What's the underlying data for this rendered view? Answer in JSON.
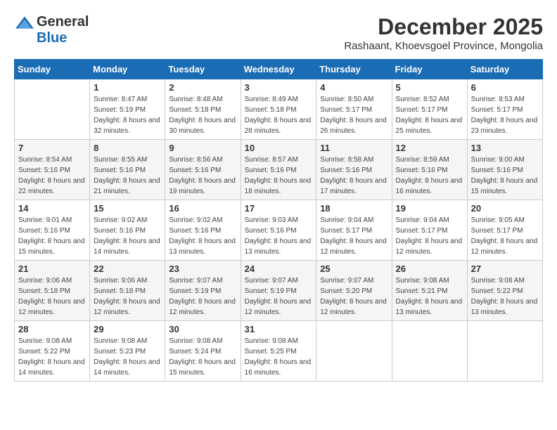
{
  "logo": {
    "general": "General",
    "blue": "Blue"
  },
  "title": {
    "month": "December 2025",
    "location": "Rashaant, Khoevsgoel Province, Mongolia"
  },
  "headers": [
    "Sunday",
    "Monday",
    "Tuesday",
    "Wednesday",
    "Thursday",
    "Friday",
    "Saturday"
  ],
  "weeks": [
    [
      {
        "day": "",
        "sunrise": "",
        "sunset": "",
        "daylight": ""
      },
      {
        "day": "1",
        "sunrise": "Sunrise: 8:47 AM",
        "sunset": "Sunset: 5:19 PM",
        "daylight": "Daylight: 8 hours and 32 minutes."
      },
      {
        "day": "2",
        "sunrise": "Sunrise: 8:48 AM",
        "sunset": "Sunset: 5:18 PM",
        "daylight": "Daylight: 8 hours and 30 minutes."
      },
      {
        "day": "3",
        "sunrise": "Sunrise: 8:49 AM",
        "sunset": "Sunset: 5:18 PM",
        "daylight": "Daylight: 8 hours and 28 minutes."
      },
      {
        "day": "4",
        "sunrise": "Sunrise: 8:50 AM",
        "sunset": "Sunset: 5:17 PM",
        "daylight": "Daylight: 8 hours and 26 minutes."
      },
      {
        "day": "5",
        "sunrise": "Sunrise: 8:52 AM",
        "sunset": "Sunset: 5:17 PM",
        "daylight": "Daylight: 8 hours and 25 minutes."
      },
      {
        "day": "6",
        "sunrise": "Sunrise: 8:53 AM",
        "sunset": "Sunset: 5:17 PM",
        "daylight": "Daylight: 8 hours and 23 minutes."
      }
    ],
    [
      {
        "day": "7",
        "sunrise": "Sunrise: 8:54 AM",
        "sunset": "Sunset: 5:16 PM",
        "daylight": "Daylight: 8 hours and 22 minutes."
      },
      {
        "day": "8",
        "sunrise": "Sunrise: 8:55 AM",
        "sunset": "Sunset: 5:16 PM",
        "daylight": "Daylight: 8 hours and 21 minutes."
      },
      {
        "day": "9",
        "sunrise": "Sunrise: 8:56 AM",
        "sunset": "Sunset: 5:16 PM",
        "daylight": "Daylight: 8 hours and 19 minutes."
      },
      {
        "day": "10",
        "sunrise": "Sunrise: 8:57 AM",
        "sunset": "Sunset: 5:16 PM",
        "daylight": "Daylight: 8 hours and 18 minutes."
      },
      {
        "day": "11",
        "sunrise": "Sunrise: 8:58 AM",
        "sunset": "Sunset: 5:16 PM",
        "daylight": "Daylight: 8 hours and 17 minutes."
      },
      {
        "day": "12",
        "sunrise": "Sunrise: 8:59 AM",
        "sunset": "Sunset: 5:16 PM",
        "daylight": "Daylight: 8 hours and 16 minutes."
      },
      {
        "day": "13",
        "sunrise": "Sunrise: 9:00 AM",
        "sunset": "Sunset: 5:16 PM",
        "daylight": "Daylight: 8 hours and 15 minutes."
      }
    ],
    [
      {
        "day": "14",
        "sunrise": "Sunrise: 9:01 AM",
        "sunset": "Sunset: 5:16 PM",
        "daylight": "Daylight: 8 hours and 15 minutes."
      },
      {
        "day": "15",
        "sunrise": "Sunrise: 9:02 AM",
        "sunset": "Sunset: 5:16 PM",
        "daylight": "Daylight: 8 hours and 14 minutes."
      },
      {
        "day": "16",
        "sunrise": "Sunrise: 9:02 AM",
        "sunset": "Sunset: 5:16 PM",
        "daylight": "Daylight: 8 hours and 13 minutes."
      },
      {
        "day": "17",
        "sunrise": "Sunrise: 9:03 AM",
        "sunset": "Sunset: 5:16 PM",
        "daylight": "Daylight: 8 hours and 13 minutes."
      },
      {
        "day": "18",
        "sunrise": "Sunrise: 9:04 AM",
        "sunset": "Sunset: 5:17 PM",
        "daylight": "Daylight: 8 hours and 12 minutes."
      },
      {
        "day": "19",
        "sunrise": "Sunrise: 9:04 AM",
        "sunset": "Sunset: 5:17 PM",
        "daylight": "Daylight: 8 hours and 12 minutes."
      },
      {
        "day": "20",
        "sunrise": "Sunrise: 9:05 AM",
        "sunset": "Sunset: 5:17 PM",
        "daylight": "Daylight: 8 hours and 12 minutes."
      }
    ],
    [
      {
        "day": "21",
        "sunrise": "Sunrise: 9:06 AM",
        "sunset": "Sunset: 5:18 PM",
        "daylight": "Daylight: 8 hours and 12 minutes."
      },
      {
        "day": "22",
        "sunrise": "Sunrise: 9:06 AM",
        "sunset": "Sunset: 5:18 PM",
        "daylight": "Daylight: 8 hours and 12 minutes."
      },
      {
        "day": "23",
        "sunrise": "Sunrise: 9:07 AM",
        "sunset": "Sunset: 5:19 PM",
        "daylight": "Daylight: 8 hours and 12 minutes."
      },
      {
        "day": "24",
        "sunrise": "Sunrise: 9:07 AM",
        "sunset": "Sunset: 5:19 PM",
        "daylight": "Daylight: 8 hours and 12 minutes."
      },
      {
        "day": "25",
        "sunrise": "Sunrise: 9:07 AM",
        "sunset": "Sunset: 5:20 PM",
        "daylight": "Daylight: 8 hours and 12 minutes."
      },
      {
        "day": "26",
        "sunrise": "Sunrise: 9:08 AM",
        "sunset": "Sunset: 5:21 PM",
        "daylight": "Daylight: 8 hours and 13 minutes."
      },
      {
        "day": "27",
        "sunrise": "Sunrise: 9:08 AM",
        "sunset": "Sunset: 5:22 PM",
        "daylight": "Daylight: 8 hours and 13 minutes."
      }
    ],
    [
      {
        "day": "28",
        "sunrise": "Sunrise: 9:08 AM",
        "sunset": "Sunset: 5:22 PM",
        "daylight": "Daylight: 8 hours and 14 minutes."
      },
      {
        "day": "29",
        "sunrise": "Sunrise: 9:08 AM",
        "sunset": "Sunset: 5:23 PM",
        "daylight": "Daylight: 8 hours and 14 minutes."
      },
      {
        "day": "30",
        "sunrise": "Sunrise: 9:08 AM",
        "sunset": "Sunset: 5:24 PM",
        "daylight": "Daylight: 8 hours and 15 minutes."
      },
      {
        "day": "31",
        "sunrise": "Sunrise: 9:08 AM",
        "sunset": "Sunset: 5:25 PM",
        "daylight": "Daylight: 8 hours and 16 minutes."
      },
      {
        "day": "",
        "sunrise": "",
        "sunset": "",
        "daylight": ""
      },
      {
        "day": "",
        "sunrise": "",
        "sunset": "",
        "daylight": ""
      },
      {
        "day": "",
        "sunrise": "",
        "sunset": "",
        "daylight": ""
      }
    ]
  ]
}
